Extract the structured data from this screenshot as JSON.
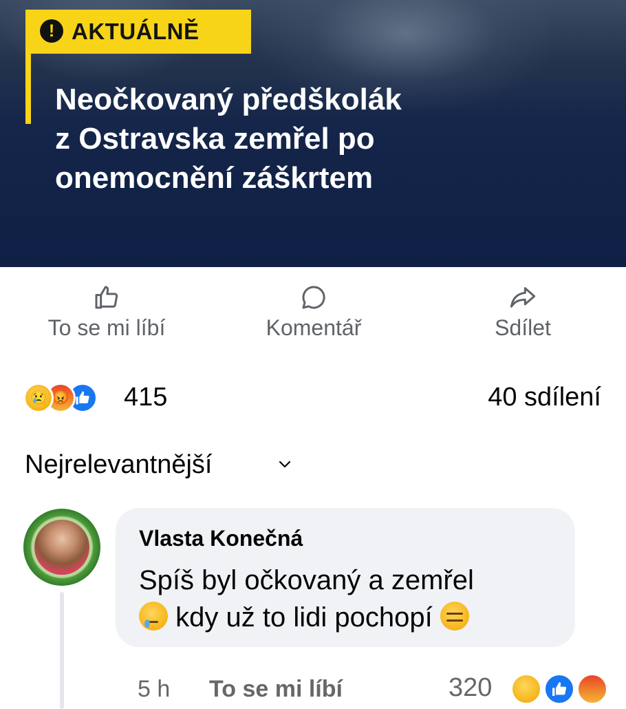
{
  "article": {
    "tag_icon": "!",
    "tag_label": "AKTUÁLNĚ",
    "headline": [
      "Neočkovaný předškolák",
      "z Ostravska zemřel po",
      "onemocnění záškrtem"
    ],
    "colors": {
      "tag": "#f7d418",
      "background": "#0f1f45"
    }
  },
  "actions": {
    "like": "To se mi líbí",
    "comment": "Komentář",
    "share": "Sdílet"
  },
  "stats": {
    "reactions": [
      "sad-emoji",
      "angry-emoji",
      "like-emoji"
    ],
    "reaction_count": "415",
    "shares": "40 sdílení"
  },
  "sort": {
    "label": "Nejrelevantnější"
  },
  "comment": {
    "author": "Vlasta Konečná",
    "line1": "Spíš byl očkovaný a zemřel",
    "line2": "kdy už to lidi pochopí",
    "time": "5 h",
    "like_label": "To se mi líbí",
    "reaction_count": "320",
    "reactions": [
      "haha-emoji",
      "like-emoji",
      "angry-emoji"
    ]
  }
}
